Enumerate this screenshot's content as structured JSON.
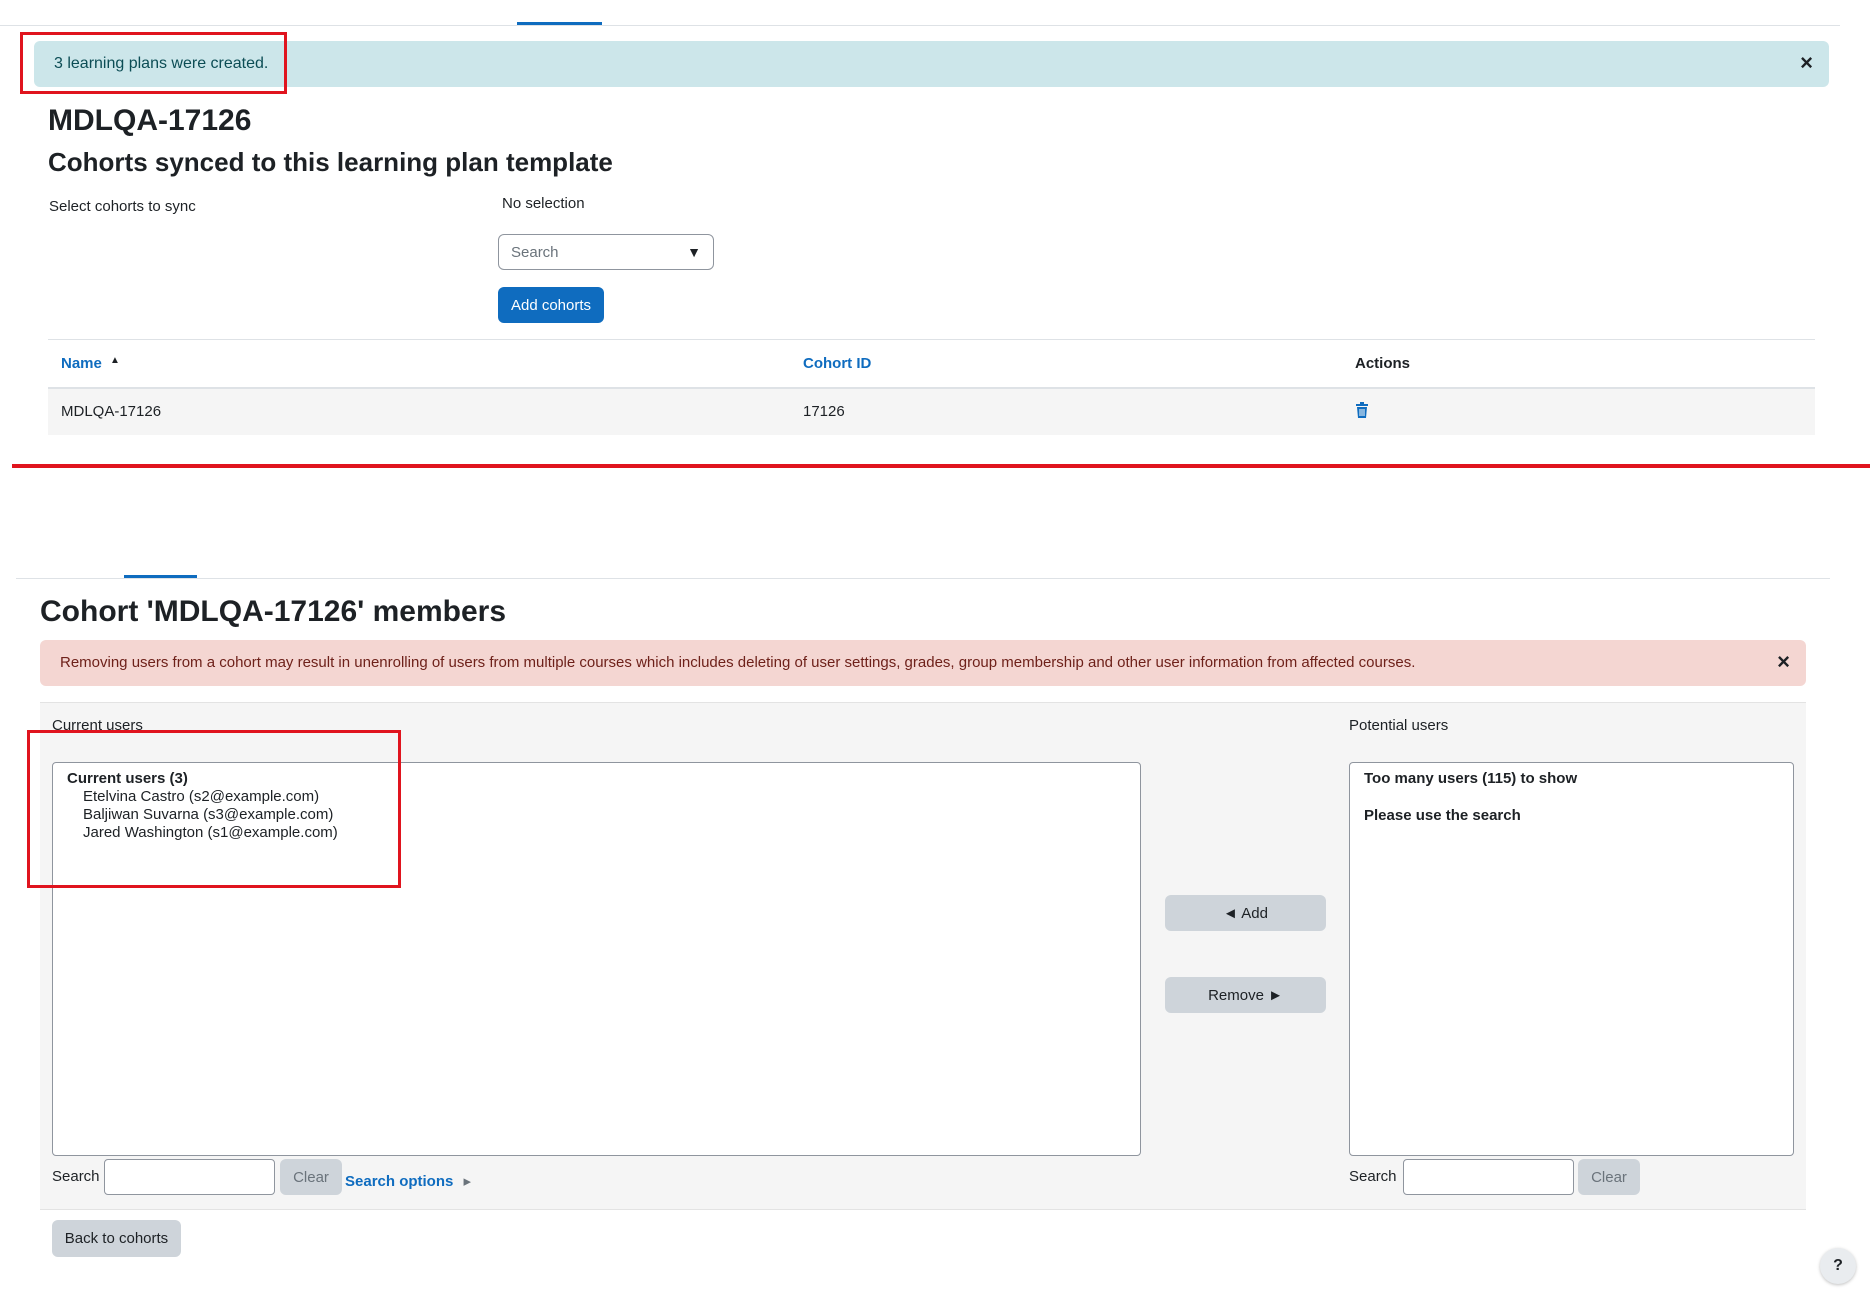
{
  "notification": {
    "success_message": "3 learning plans were created.",
    "close_symbol": "×"
  },
  "template": {
    "title": "MDLQA-17126",
    "section_heading": "Cohorts synced to this learning plan template",
    "select_label": "Select cohorts to sync",
    "selection_status": "No selection",
    "search_placeholder": "Search",
    "dropdown_arrow": "▼",
    "add_button": "Add cohorts",
    "table": {
      "headers": {
        "name": "Name",
        "sort_indicator": "▲",
        "cohort_id": "Cohort ID",
        "actions": "Actions"
      },
      "rows": [
        {
          "name": "MDLQA-17126",
          "cohort_id": "17126",
          "action_icon": "trash-icon"
        }
      ]
    }
  },
  "cohort": {
    "heading": "Cohort 'MDLQA-17126' members",
    "warning": "Removing users from a cohort may result in unenrolling of users from multiple courses which includes deleting of user settings, grades, group membership and other user information from affected courses.",
    "close_symbol": "×",
    "current": {
      "label": "Current users",
      "group_label": "Current users (3)",
      "users": [
        "Etelvina Castro (s2@example.com)",
        "Baljiwan Suvarna (s3@example.com)",
        "Jared Washington (s1@example.com)"
      ],
      "search_label": "Search",
      "clear_button": "Clear",
      "search_options_link": "Search options",
      "search_options_caret": "▸"
    },
    "potential": {
      "label": "Potential users",
      "message_line1": "Too many users (115) to show",
      "message_line2": "Please use the search",
      "search_label": "Search",
      "clear_button": "Clear"
    },
    "add_button": "◄ Add",
    "remove_button": "Remove ►",
    "back_button": "Back to cohorts",
    "help_symbol": "?"
  },
  "colors": {
    "primary": "#0f6cbf",
    "success_bg": "#cce6ea",
    "danger_bg": "#f4d6d2",
    "highlight_red": "#e0141e"
  }
}
